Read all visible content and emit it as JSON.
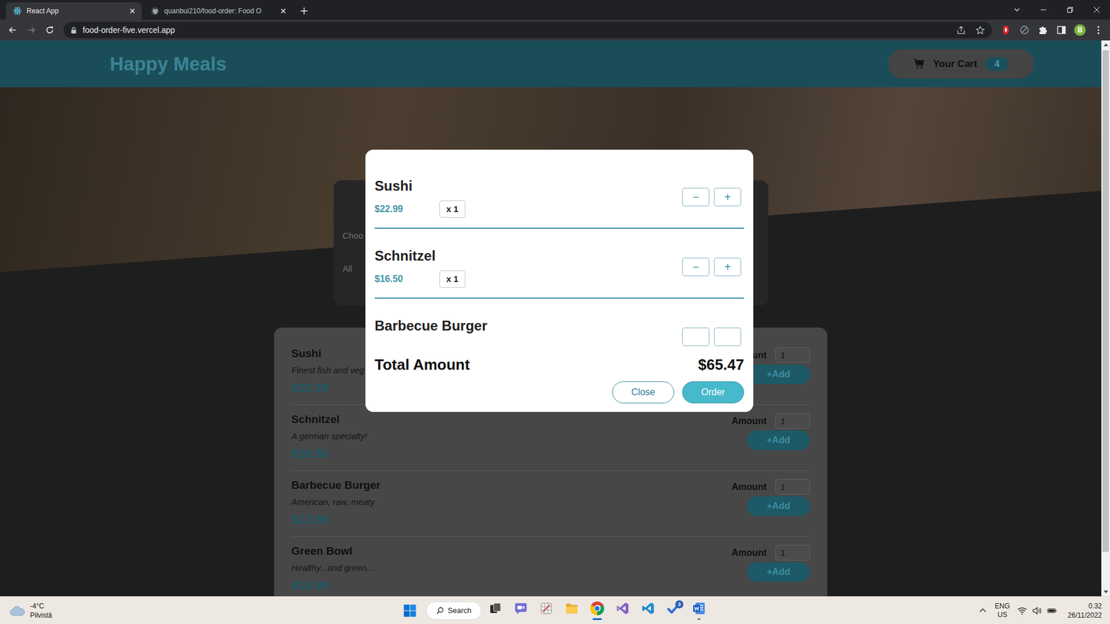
{
  "browser": {
    "tabs": [
      {
        "title": "React App",
        "kind": "react",
        "selected": true
      },
      {
        "title": "quanbui210/food-order: Food O",
        "kind": "github",
        "selected": false
      }
    ],
    "address": "food-order-five.vercel.app",
    "profile": "B"
  },
  "app": {
    "header": {
      "title": "Happy Meals",
      "cartLabel": "Your Cart",
      "cartCount": "4"
    },
    "summary": {
      "lines": [
        "Choo",
        "All"
      ]
    },
    "menu": [
      {
        "name": "Sushi",
        "description": "Finest fish and veg",
        "price": "$22.99",
        "amountLabel": "ount",
        "amount": "1",
        "addLabel": "+Add"
      },
      {
        "name": "Schnitzel",
        "description": "A german specialty!",
        "price": "$16.50",
        "amountLabel": "Amount",
        "amount": "1",
        "addLabel": "+Add"
      },
      {
        "name": "Barbecue Burger",
        "description": "American, raw, meaty",
        "price": "$12.99",
        "amountLabel": "Amount",
        "amount": "1",
        "addLabel": "+Add"
      },
      {
        "name": "Green Bowl",
        "description": "Healthy...and green...",
        "price": "$18.99",
        "amountLabel": "Amount",
        "amount": "1",
        "addLabel": "+Add"
      }
    ],
    "cart": {
      "items": [
        {
          "name": "Sushi",
          "price": "$22.99",
          "quantity": "x 1",
          "decrease": "−",
          "increase": "+"
        },
        {
          "name": "Schnitzel",
          "price": "$16.50",
          "quantity": "x 1",
          "decrease": "−",
          "increase": "+"
        },
        {
          "name": "Barbecue Burger"
        }
      ],
      "totalLabel": "Total Amount",
      "total": "$65.47",
      "buttons": [
        {
          "label": "Close",
          "kind": "outline"
        },
        {
          "label": "Order",
          "kind": "primary"
        }
      ]
    }
  },
  "taskbar": {
    "weather": {
      "temperature": "-4°C",
      "condition": "Pilvistä"
    },
    "search": "Search",
    "apps": [
      {
        "kind": "task-view",
        "open": false,
        "active": false
      },
      {
        "kind": "chat",
        "open": false,
        "active": false
      },
      {
        "kind": "snipping",
        "open": false,
        "active": false
      },
      {
        "kind": "explorer",
        "open": false,
        "active": false
      },
      {
        "kind": "chrome",
        "open": true,
        "active": true
      },
      {
        "kind": "visual-studio",
        "open": false,
        "active": false
      },
      {
        "kind": "vscode",
        "open": false,
        "active": false
      },
      {
        "kind": "todo",
        "open": false,
        "active": false,
        "badge": "3"
      },
      {
        "kind": "word",
        "open": true,
        "active": false
      }
    ],
    "tray": {
      "language": "ENG",
      "region": "US",
      "time": "0.32",
      "date": "26/11/2022"
    }
  }
}
